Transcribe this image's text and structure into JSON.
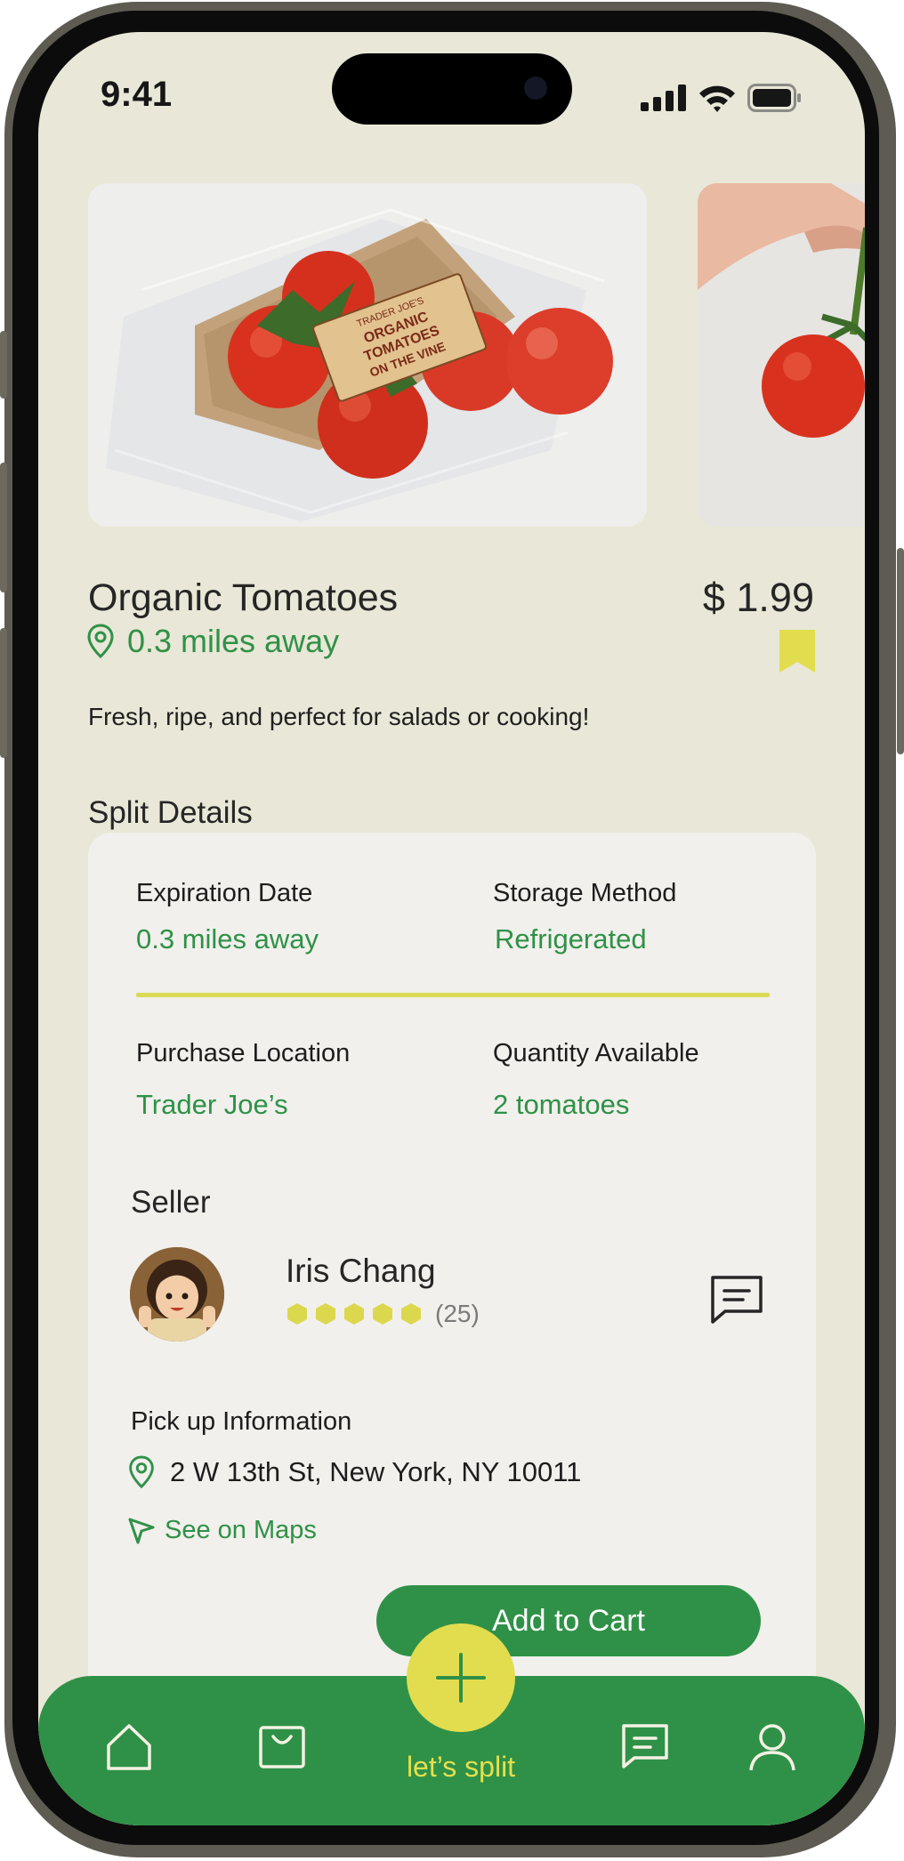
{
  "status_bar": {
    "time": "9:41"
  },
  "product": {
    "title": "Organic Tomatoes",
    "price": "$ 1.99",
    "distance": "0.3 miles away",
    "description": "Fresh, ripe, and perfect for salads or cooking!",
    "photo_label_lines": [
      "ORGANIC",
      "TOMATOES",
      "ON THE VINE"
    ],
    "photo_label_brand": "TRADER JOE'S"
  },
  "split_details": {
    "heading": "Split Details",
    "expiration_label": "Expiration Date",
    "expiration_value": "0.3 miles away",
    "storage_label": "Storage Method",
    "storage_value": "Refrigerated",
    "location_label": "Purchase Location",
    "location_value": "Trader Joe’s",
    "quantity_label": "Quantity Available",
    "quantity_value": "2 tomatoes"
  },
  "seller": {
    "heading": "Seller",
    "name": "Iris Chang",
    "rating": 5,
    "rating_count": "(25)"
  },
  "pickup": {
    "heading": "Pick up Information",
    "address": "2 W 13th St, New York, NY 10011",
    "maps_link": "See on Maps"
  },
  "actions": {
    "add_to_cart": "Add to Cart"
  },
  "nav": {
    "center_label": "let’s split",
    "items": [
      "home-icon",
      "shopping-bag-icon",
      "plus-icon",
      "chat-icon",
      "profile-icon"
    ]
  },
  "colors": {
    "brand_green": "#2f9147",
    "accent_yellow": "#e1dd4f",
    "background": "#e9e7d7",
    "card": "#f1f0ec"
  }
}
